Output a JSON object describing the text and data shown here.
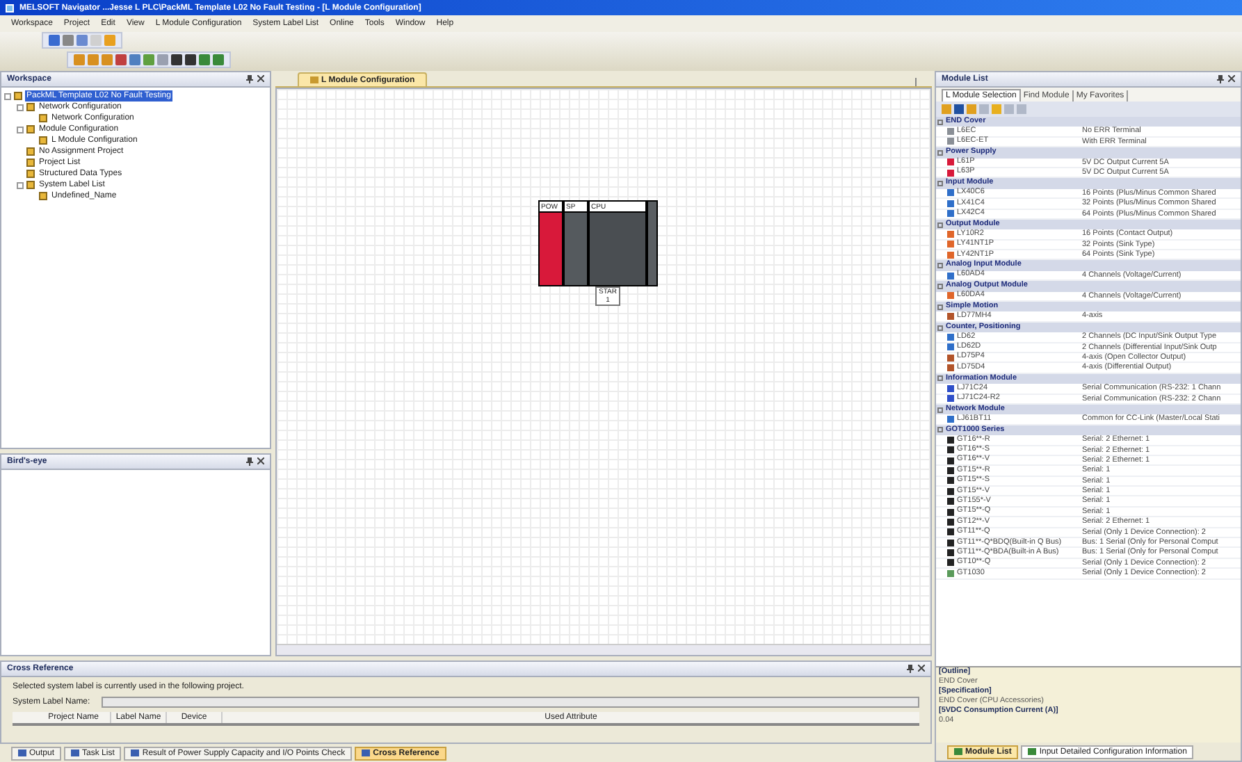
{
  "window": {
    "title": "MELSOFT Navigator ...Jesse L PLC\\PackML Template L02 No Fault Testing - [L Module Configuration]"
  },
  "menu": [
    "Workspace",
    "Project",
    "Edit",
    "View",
    "L Module Configuration",
    "System Label List",
    "Online",
    "Tools",
    "Window",
    "Help"
  ],
  "workspace": {
    "title": "Workspace",
    "tree": [
      {
        "label": "PackML Template L02 No Fault Testing",
        "selected": true,
        "children": [
          {
            "label": "Network Configuration",
            "selected": false,
            "children": [
              {
                "label": "Network Configuration",
                "selected": false
              }
            ]
          },
          {
            "label": "Module Configuration",
            "selected": false,
            "children": [
              {
                "label": "L Module Configuration",
                "selected": false
              }
            ]
          },
          {
            "label": "No Assignment Project",
            "selected": false
          },
          {
            "label": "Project List",
            "selected": false
          },
          {
            "label": "Structured Data Types",
            "selected": false
          },
          {
            "label": "System Label List",
            "selected": false,
            "children": [
              {
                "label": "Undefined_Name",
                "selected": false
              }
            ]
          }
        ]
      }
    ]
  },
  "birds_eye": {
    "title": "Bird's-eye"
  },
  "editor": {
    "tab": "L Module Configuration",
    "modules": [
      {
        "label": "POW",
        "color": "#d8193a"
      },
      {
        "label": "SP",
        "color": "#555a5e"
      },
      {
        "label": "CPU",
        "color": "#4a4e52"
      }
    ],
    "end_label": "STAR",
    "end_number": "1"
  },
  "cross_reference": {
    "title": "Cross Reference",
    "message": "Selected system label is currently used in the following project.",
    "field_label": "System Label Name:",
    "columns": [
      "Project Name",
      "Label Name",
      "Device",
      "Used Attribute"
    ]
  },
  "bottom_tabs": [
    {
      "label": "Output",
      "selected": false
    },
    {
      "label": "Task List",
      "selected": false
    },
    {
      "label": "Result of Power Supply Capacity and I/O Points Check",
      "selected": false
    },
    {
      "label": "Cross Reference",
      "selected": true
    }
  ],
  "module_list": {
    "title": "Module List",
    "tabs": [
      {
        "label": "L Module Selection",
        "selected": true
      },
      {
        "label": "Find Module",
        "selected": false
      },
      {
        "label": "My Favorites",
        "selected": false
      }
    ],
    "groups": [
      {
        "name": "END Cover",
        "items": [
          {
            "name": "L6EC",
            "desc": "No ERR Terminal",
            "color": "#8a8f96"
          },
          {
            "name": "L6EC-ET",
            "desc": "With ERR Terminal",
            "color": "#8a8f96"
          }
        ]
      },
      {
        "name": "Power Supply",
        "items": [
          {
            "name": "L61P",
            "desc": "5V DC Output Current 5A",
            "color": "#d8193a"
          },
          {
            "name": "L63P",
            "desc": "5V DC Output Current 5A",
            "color": "#d8193a"
          }
        ]
      },
      {
        "name": "Input Module",
        "items": [
          {
            "name": "LX40C6",
            "desc": "16 Points (Plus/Minus Common Shared",
            "color": "#2f6fc9"
          },
          {
            "name": "LX41C4",
            "desc": "32 Points (Plus/Minus Common Shared",
            "color": "#2f6fc9"
          },
          {
            "name": "LX42C4",
            "desc": "64 Points (Plus/Minus Common Shared",
            "color": "#2f6fc9"
          }
        ]
      },
      {
        "name": "Output Module",
        "items": [
          {
            "name": "LY10R2",
            "desc": "16 Points (Contact Output)",
            "color": "#e0662a"
          },
          {
            "name": "LY41NT1P",
            "desc": "32 Points (Sink Type)",
            "color": "#e0662a"
          },
          {
            "name": "LY42NT1P",
            "desc": "64 Points (Sink Type)",
            "color": "#e0662a"
          }
        ]
      },
      {
        "name": "Analog Input Module",
        "items": [
          {
            "name": "L60AD4",
            "desc": "4 Channels (Voltage/Current)",
            "color": "#2f6fc9"
          }
        ]
      },
      {
        "name": "Analog Output Module",
        "items": [
          {
            "name": "L60DA4",
            "desc": "4 Channels (Voltage/Current)",
            "color": "#e0662a"
          }
        ]
      },
      {
        "name": "Simple Motion",
        "items": [
          {
            "name": "LD77MH4",
            "desc": "4-axis",
            "color": "#b2542a"
          }
        ]
      },
      {
        "name": "Counter, Positioning",
        "items": [
          {
            "name": "LD62",
            "desc": "2 Channels (DC Input/Sink Output Type",
            "color": "#2f6fc9"
          },
          {
            "name": "LD62D",
            "desc": "2 Channels (Differential Input/Sink Outp",
            "color": "#2f6fc9"
          },
          {
            "name": "LD75P4",
            "desc": "4-axis (Open Collector Output)",
            "color": "#b2542a"
          },
          {
            "name": "LD75D4",
            "desc": "4-axis (Differential Output)",
            "color": "#b2542a"
          }
        ]
      },
      {
        "name": "Information Module",
        "items": [
          {
            "name": "LJ71C24",
            "desc": "Serial Communication (RS-232: 1 Chann",
            "color": "#2f4fc9"
          },
          {
            "name": "LJ71C24-R2",
            "desc": "Serial Communication (RS-232: 2 Chann",
            "color": "#2f4fc9"
          }
        ]
      },
      {
        "name": "Network Module",
        "items": [
          {
            "name": "LJ61BT11",
            "desc": "Common for CC-Link (Master/Local Stati",
            "color": "#2f6fc9"
          }
        ]
      },
      {
        "name": "GOT1000 Series",
        "items": [
          {
            "name": "GT16**-R",
            "desc": "Serial: 2 Ethernet: 1",
            "color": "#222222"
          },
          {
            "name": "GT16**-S",
            "desc": "Serial: 2 Ethernet: 1",
            "color": "#222222"
          },
          {
            "name": "GT16**-V",
            "desc": "Serial: 2 Ethernet: 1",
            "color": "#222222"
          },
          {
            "name": "GT15**-R",
            "desc": "Serial: 1",
            "color": "#222222"
          },
          {
            "name": "GT15**-S",
            "desc": "Serial: 1",
            "color": "#222222"
          },
          {
            "name": "GT15**-V",
            "desc": "Serial: 1",
            "color": "#222222"
          },
          {
            "name": "GT155*-V",
            "desc": "Serial: 1",
            "color": "#222222"
          },
          {
            "name": "GT15**-Q",
            "desc": "Serial: 1",
            "color": "#222222"
          },
          {
            "name": "GT12**-V",
            "desc": "Serial: 2 Ethernet: 1",
            "color": "#222222"
          },
          {
            "name": "GT11**-Q",
            "desc": "Serial (Only 1 Device Connection): 2",
            "color": "#222222"
          },
          {
            "name": "GT11**-Q*BDQ(Built-in Q Bus)",
            "desc": "Bus: 1 Serial (Only for Personal Comput",
            "color": "#222222"
          },
          {
            "name": "GT11**-Q*BDA(Built-in A Bus)",
            "desc": "Bus: 1 Serial (Only for Personal Comput",
            "color": "#222222"
          },
          {
            "name": "GT10**-Q",
            "desc": "Serial (Only 1 Device Connection): 2",
            "color": "#222222"
          },
          {
            "name": "GT1030",
            "desc": "Serial (Only 1 Device Connection): 2",
            "color": "#5a9a5a"
          }
        ]
      }
    ]
  },
  "outline": [
    "[Outline]",
    "END Cover",
    "[Specification]",
    "END Cover (CPU Accessories)",
    "[5VDC Consumption Current (A)]",
    "0.04"
  ],
  "right_tabs": [
    {
      "label": "Module List",
      "selected": true
    },
    {
      "label": "Input Detailed Configuration Information",
      "selected": false
    }
  ]
}
